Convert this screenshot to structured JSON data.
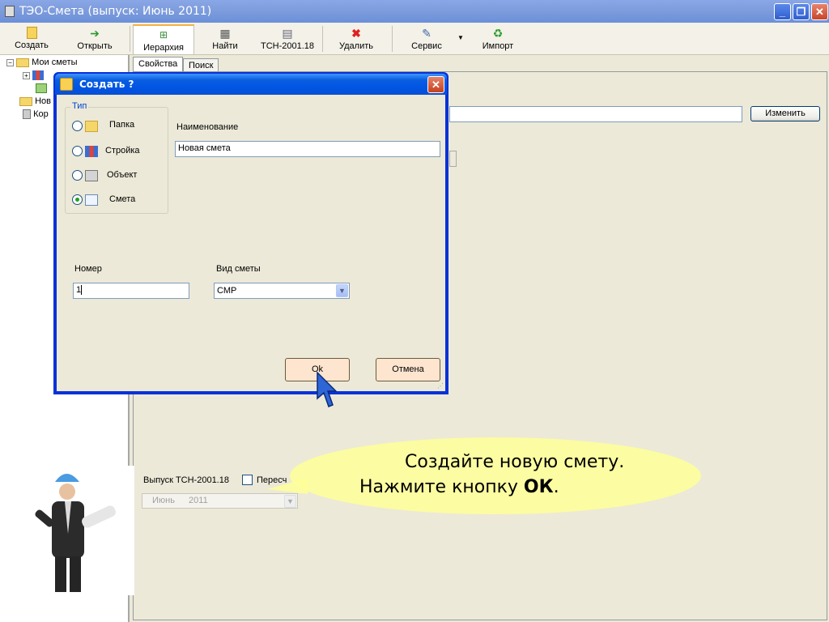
{
  "window": {
    "title": "ТЭО-Смета  (выпуск: Июнь 2011)",
    "minimize": "_",
    "restore": "❐",
    "close": "✕"
  },
  "toolbar": {
    "create": "Создать",
    "open": "Открыть",
    "hierarchy": "Иерархия",
    "find": "Найти",
    "tsn": "ТСН-2001.18",
    "delete": "Удалить",
    "service": "Сервис",
    "import": "Импорт"
  },
  "tree": {
    "root": "Мои сметы",
    "items": [
      "Нов",
      "Кор"
    ]
  },
  "content": {
    "tabs": [
      "Свойства",
      "Поиск"
    ],
    "change_button": "Изменить",
    "release_label": "Выпуск ТСН-2001.18",
    "recalc_label": "Пересч",
    "release_month": "Июнь",
    "release_year": "2011"
  },
  "dialog": {
    "title": "Создать ?",
    "type_group": "Тип",
    "types": [
      "Папка",
      "Стройка",
      "Объект",
      "Смета"
    ],
    "selected_type": "Смета",
    "name_label": "Наименование",
    "name_value": "Новая смета",
    "number_label": "Номер",
    "number_value": "1",
    "kind_label": "Вид сметы",
    "kind_value": "СМР",
    "ok": "Ok",
    "cancel": "Отмена"
  },
  "callout": {
    "line1": "Создайте  новую  смету.",
    "line2_prefix": "Нажмите кнопку ",
    "line2_bold": "ОК",
    "line2_suffix": "."
  },
  "colors": {
    "titlebar": "#7f9edd",
    "dialog_title": "#0054e3",
    "callout": "#ffff99",
    "highlight_button": "#fde5cf"
  },
  "icons": [
    "create-icon",
    "open-icon",
    "hierarchy-icon",
    "find-icon",
    "tsn-icon",
    "delete-icon",
    "service-icon",
    "import-icon",
    "folder-icon",
    "construction-icon",
    "object-icon",
    "estimate-icon",
    "cursor-icon"
  ]
}
